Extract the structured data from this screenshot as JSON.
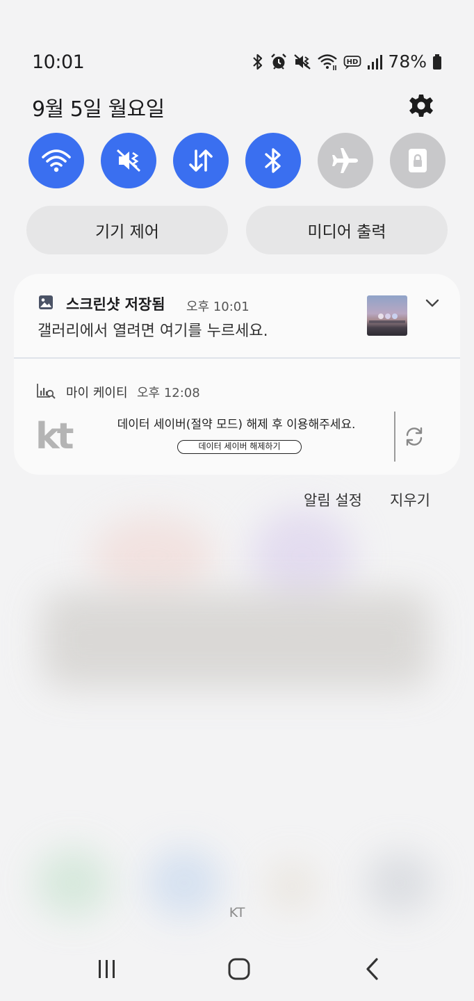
{
  "status_bar": {
    "time": "10:01",
    "battery_percent": "78%",
    "icons": [
      "bluetooth-icon",
      "alarm-icon",
      "vibrate-icon",
      "wifi-icon",
      "hd-icon",
      "signal-icon",
      "battery-icon"
    ]
  },
  "header": {
    "date": "9월 5일 월요일",
    "settings_icon": "gear-icon"
  },
  "quick_settings": [
    {
      "name": "wifi",
      "icon": "wifi-icon",
      "active": true
    },
    {
      "name": "sound",
      "icon": "mute-vibrate-icon",
      "active": true
    },
    {
      "name": "mobile-data",
      "icon": "data-arrows-icon",
      "active": true
    },
    {
      "name": "bluetooth",
      "icon": "bluetooth-icon",
      "active": true
    },
    {
      "name": "airplane",
      "icon": "airplane-icon",
      "active": false
    },
    {
      "name": "secure-folder",
      "icon": "lock-icon",
      "active": false
    }
  ],
  "panel_buttons": {
    "device_control": "기기 제어",
    "media_output": "미디어 출력"
  },
  "notifications": {
    "screenshot": {
      "title": "스크린샷 저장됨",
      "time": "오후 10:01",
      "body": "갤러리에서 열려면 여기를 누르세요."
    },
    "kt": {
      "app_name": "마이 케이티",
      "time": "오후 12:08",
      "logo": "kt",
      "message": "데이터 세이버(절약 모드) 해제 후 이용해주세요.",
      "button": "데이터 세이버 해제하기"
    }
  },
  "actions": {
    "notification_settings": "알림 설정",
    "clear": "지우기"
  },
  "carrier": "KT",
  "colors": {
    "accent": "#3a6ff0",
    "inactive": "#c8c8ca",
    "background": "#f3f3f4"
  }
}
